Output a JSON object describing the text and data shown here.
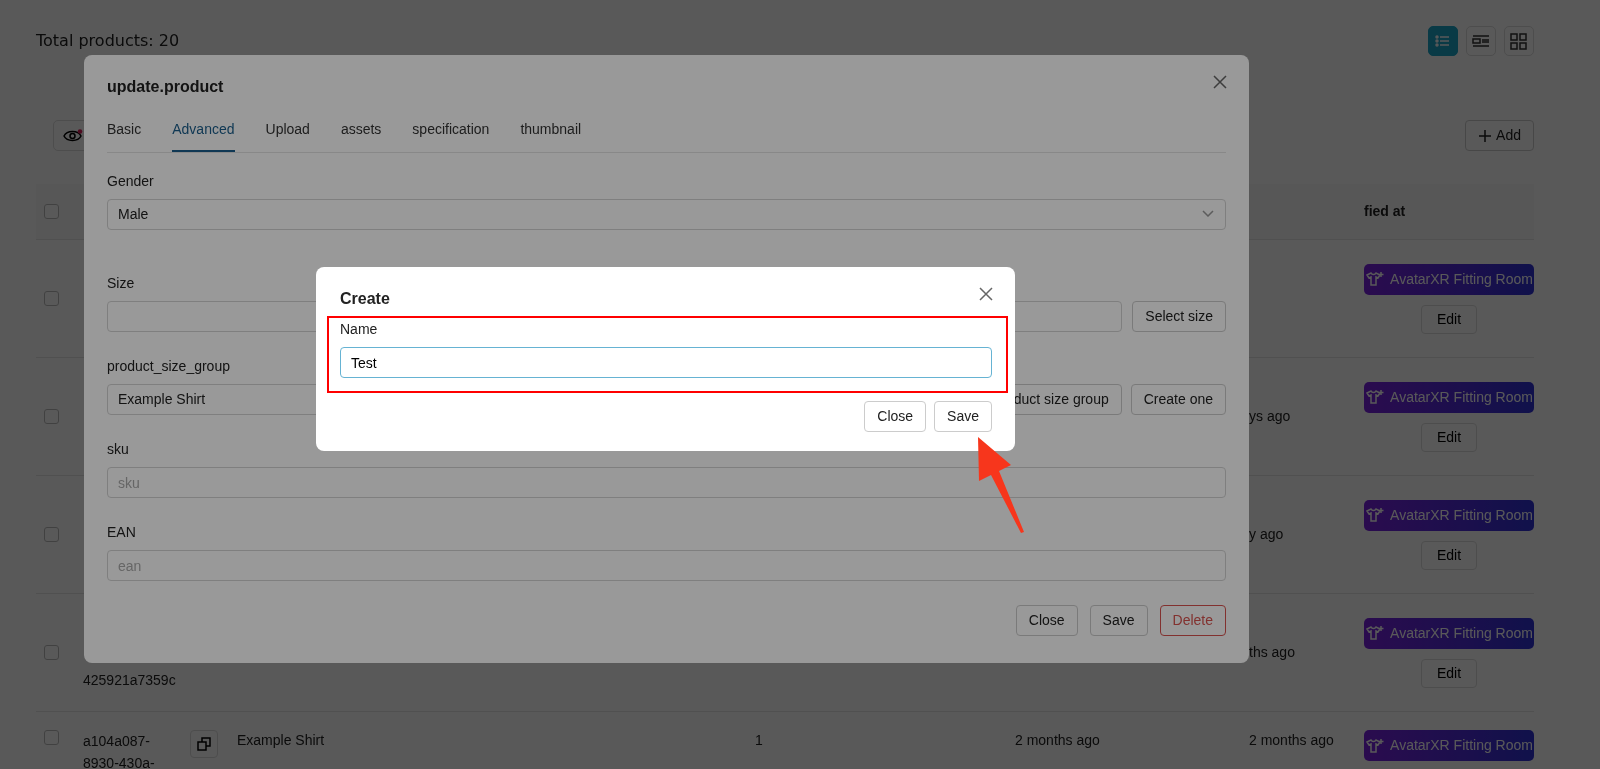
{
  "page": {
    "title": "Total products: 20",
    "view_modes": [
      {
        "kind": "list",
        "selected": true
      },
      {
        "kind": "detail",
        "selected": false
      },
      {
        "kind": "grid",
        "selected": false
      }
    ],
    "add_button": "Add"
  },
  "table": {
    "header": {
      "checked": false,
      "modified_at": "fied at"
    },
    "rows": [
      {
        "checked": false,
        "fitting_button": "AvatarXR Fitting Room",
        "edit_button": "Edit"
      },
      {
        "checked": false,
        "modified": "ys ago",
        "fitting_button": "AvatarXR Fitting Room",
        "edit_button": "Edit"
      },
      {
        "checked": false,
        "modified": "y ago",
        "fitting_button": "AvatarXR Fitting Room",
        "edit_button": "Edit"
      },
      {
        "checked": false,
        "id_lines": [
          "425921a7359c"
        ],
        "modified": "ths ago",
        "fitting_button": "AvatarXR Fitting Room",
        "edit_button": "Edit"
      },
      {
        "checked": false,
        "id_lines": [
          "a104a087-",
          "8930-430a-"
        ],
        "copy": true,
        "name": "Example Shirt",
        "quantity": "1",
        "created": "2 months ago",
        "modified": "2 months ago",
        "fitting_button": "AvatarXR Fitting Room"
      }
    ]
  },
  "update_modal": {
    "title": "update.product",
    "tabs": [
      {
        "label": "Basic",
        "selected": false
      },
      {
        "label": "Advanced",
        "selected": true
      },
      {
        "label": "Upload",
        "selected": false
      },
      {
        "label": "assets",
        "selected": false
      },
      {
        "label": "specification",
        "selected": false
      },
      {
        "label": "thumbnail",
        "selected": false
      }
    ],
    "fields": [
      {
        "kind": "select",
        "label": "Gender",
        "value": "Male"
      },
      {
        "kind": "input_button",
        "label": "Size",
        "buttons": [
          "Select size"
        ]
      },
      {
        "kind": "select_buttons",
        "label": "product_size_group",
        "value": "Example Shirt",
        "buttons": [
          "duct size group",
          "Create one"
        ]
      },
      {
        "kind": "text",
        "label": "sku",
        "placeholder": "sku"
      },
      {
        "kind": "text",
        "label": "EAN",
        "placeholder": "ean"
      }
    ],
    "buttons": [
      {
        "label": "Close",
        "kind": "default"
      },
      {
        "label": "Save",
        "kind": "default"
      },
      {
        "label": "Delete",
        "kind": "danger"
      }
    ]
  },
  "create_modal": {
    "title": "Create",
    "field": {
      "label": "Name",
      "value": "Test"
    },
    "buttons": [
      "Close",
      "Save"
    ]
  }
}
